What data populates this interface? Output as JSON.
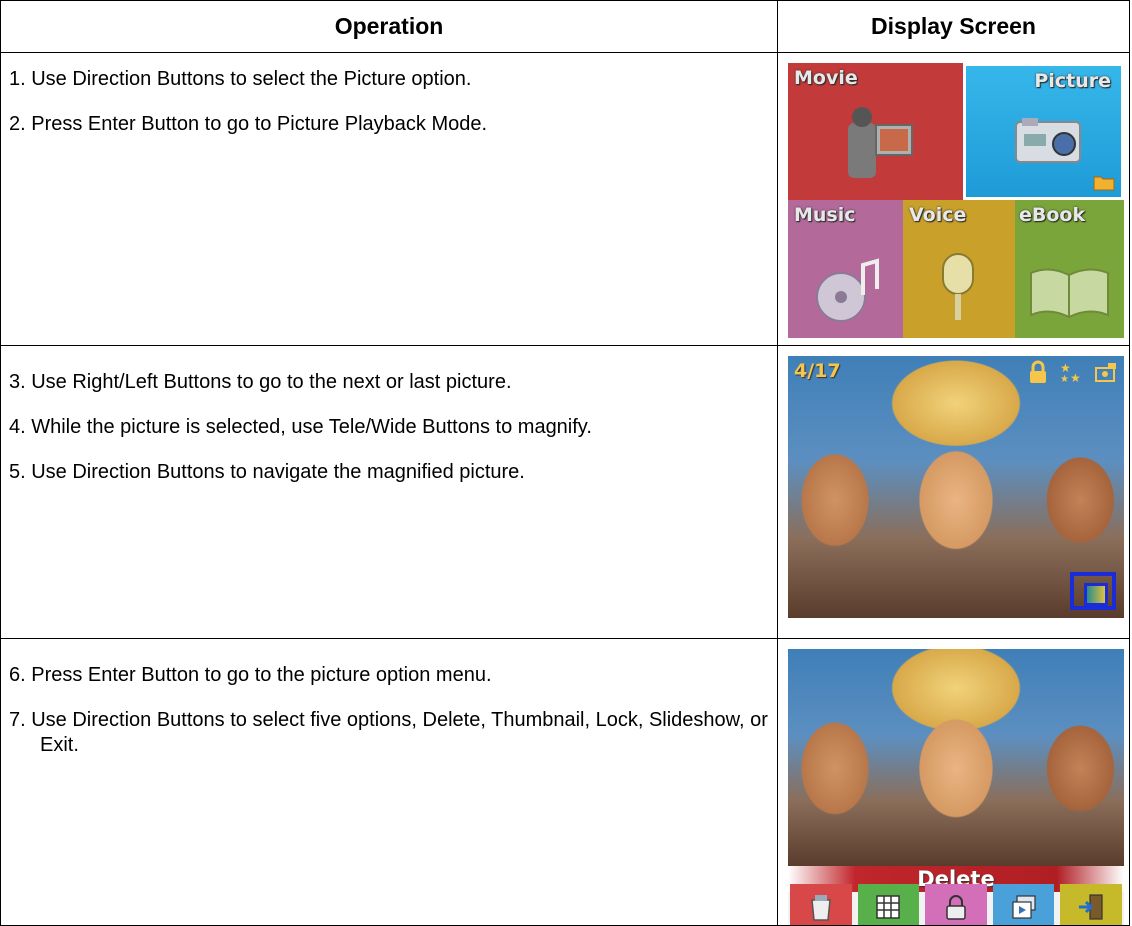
{
  "table": {
    "header_operation": "Operation",
    "header_display": "Display Screen"
  },
  "rows": [
    {
      "steps": [
        "1. Use Direction Buttons to select the Picture option.",
        "2. Press Enter Button to go to Picture Playback Mode."
      ]
    },
    {
      "steps": [
        "3. Use Right/Left Buttons to go to the next or last picture.",
        "4. While the picture is selected, use Tele/Wide Buttons to magnify.",
        "5. Use Direction Buttons to navigate the magnified picture."
      ]
    },
    {
      "steps": [
        "6. Press Enter Button to go to the picture option menu.",
        "7. Use Direction Buttons to select five options, Delete, Thumbnail, Lock, Slideshow, or Exit."
      ]
    }
  ],
  "menu_screen": {
    "tiles": [
      "Movie",
      "Picture",
      "Music",
      "Voice",
      "eBook"
    ],
    "selected": "Picture",
    "icons": [
      "camcorder-icon",
      "camera-icon",
      "cd-music-icon",
      "microphone-icon",
      "open-book-icon"
    ]
  },
  "playback_screen": {
    "counter": "4/17",
    "icons": [
      "lock-icon",
      "stars-icon",
      "camera-small-icon"
    ],
    "zoom_indicator": true
  },
  "option_screen": {
    "selected_label": "Delete",
    "options": [
      "delete-icon",
      "thumbnail-icon",
      "lock-icon",
      "slideshow-icon",
      "exit-icon"
    ],
    "colors": [
      "#d84848",
      "#58b04a",
      "#d36fb9",
      "#4aa0d8",
      "#c6b92a"
    ]
  }
}
